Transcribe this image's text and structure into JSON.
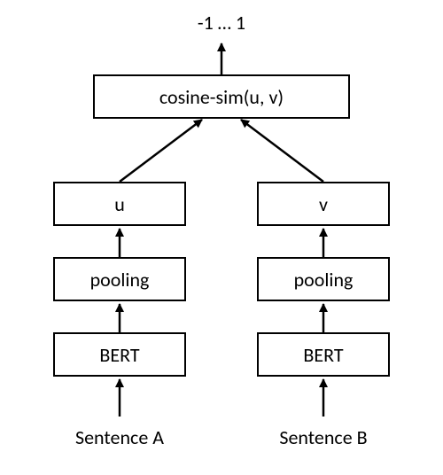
{
  "output_range": "-1 … 1",
  "top_box": "cosine-sim(u, v)",
  "left": {
    "embedding": "u",
    "pooling": "pooling",
    "encoder": "BERT",
    "input": "Sentence A"
  },
  "right": {
    "embedding": "v",
    "pooling": "pooling",
    "encoder": "BERT",
    "input": "Sentence B"
  }
}
